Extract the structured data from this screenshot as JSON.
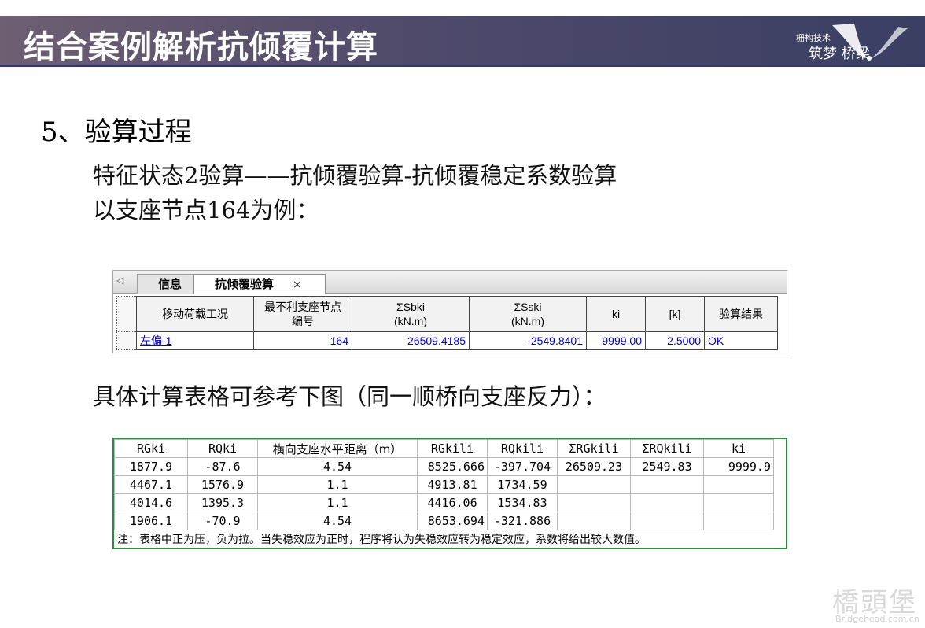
{
  "header": {
    "title": "结合案例解析抗倾覆计算",
    "logo_small": "栅构技术",
    "logo_big": "筑梦 桥梁"
  },
  "section": {
    "heading": "5、验算过程",
    "line1": "特征状态2验算——抗倾覆验算-抗倾覆稳定系数验算",
    "line2": "以支座节点164为例：",
    "line3": "具体计算表格可参考下图（同一顺桥向支座反力）："
  },
  "app_panel": {
    "tabs": [
      {
        "label": "信息"
      },
      {
        "label": "抗倾覆验算"
      }
    ],
    "close_glyph": "×",
    "columns": [
      "移动荷载工况",
      "最不利支座节点编号",
      "ΣSbki\n(kN.m)",
      "ΣSski\n(kN.m)",
      "ki",
      "[k]",
      "验算结果"
    ],
    "row": {
      "case": "左偏-1",
      "node": "164",
      "sbki": "26509.4185",
      "sski": "-2549.8401",
      "ki": "9999.00",
      "k": "2.5000",
      "result": "OK"
    }
  },
  "ref_table": {
    "headers": [
      "RGki",
      "RQki",
      "横向支座水平距离（m）",
      "RGkili",
      "RQkili",
      "ΣRGkili",
      "ΣRQkili",
      "ki"
    ],
    "rows": [
      [
        "1877.9",
        "-87.6",
        "4.54",
        "8525.666",
        "-397.704",
        "26509.23",
        "2549.83",
        "9999.9"
      ],
      [
        "4467.1",
        "1576.9",
        "1.1",
        "4913.81",
        "1734.59",
        "",
        "",
        ""
      ],
      [
        "4014.6",
        "1395.3",
        "1.1",
        "4416.06",
        "1534.83",
        "",
        "",
        ""
      ],
      [
        "1906.1",
        "-70.9",
        "4.54",
        "8653.694",
        "-321.886",
        "",
        "",
        ""
      ]
    ],
    "note": "注：表格中正为压，负为拉。当失稳效应为正时，程序将认为失稳效应转为稳定效应，系数将给出较大数值。"
  },
  "watermark": {
    "text": "橋頭堡",
    "url": "Bridgehead.com.cn"
  }
}
